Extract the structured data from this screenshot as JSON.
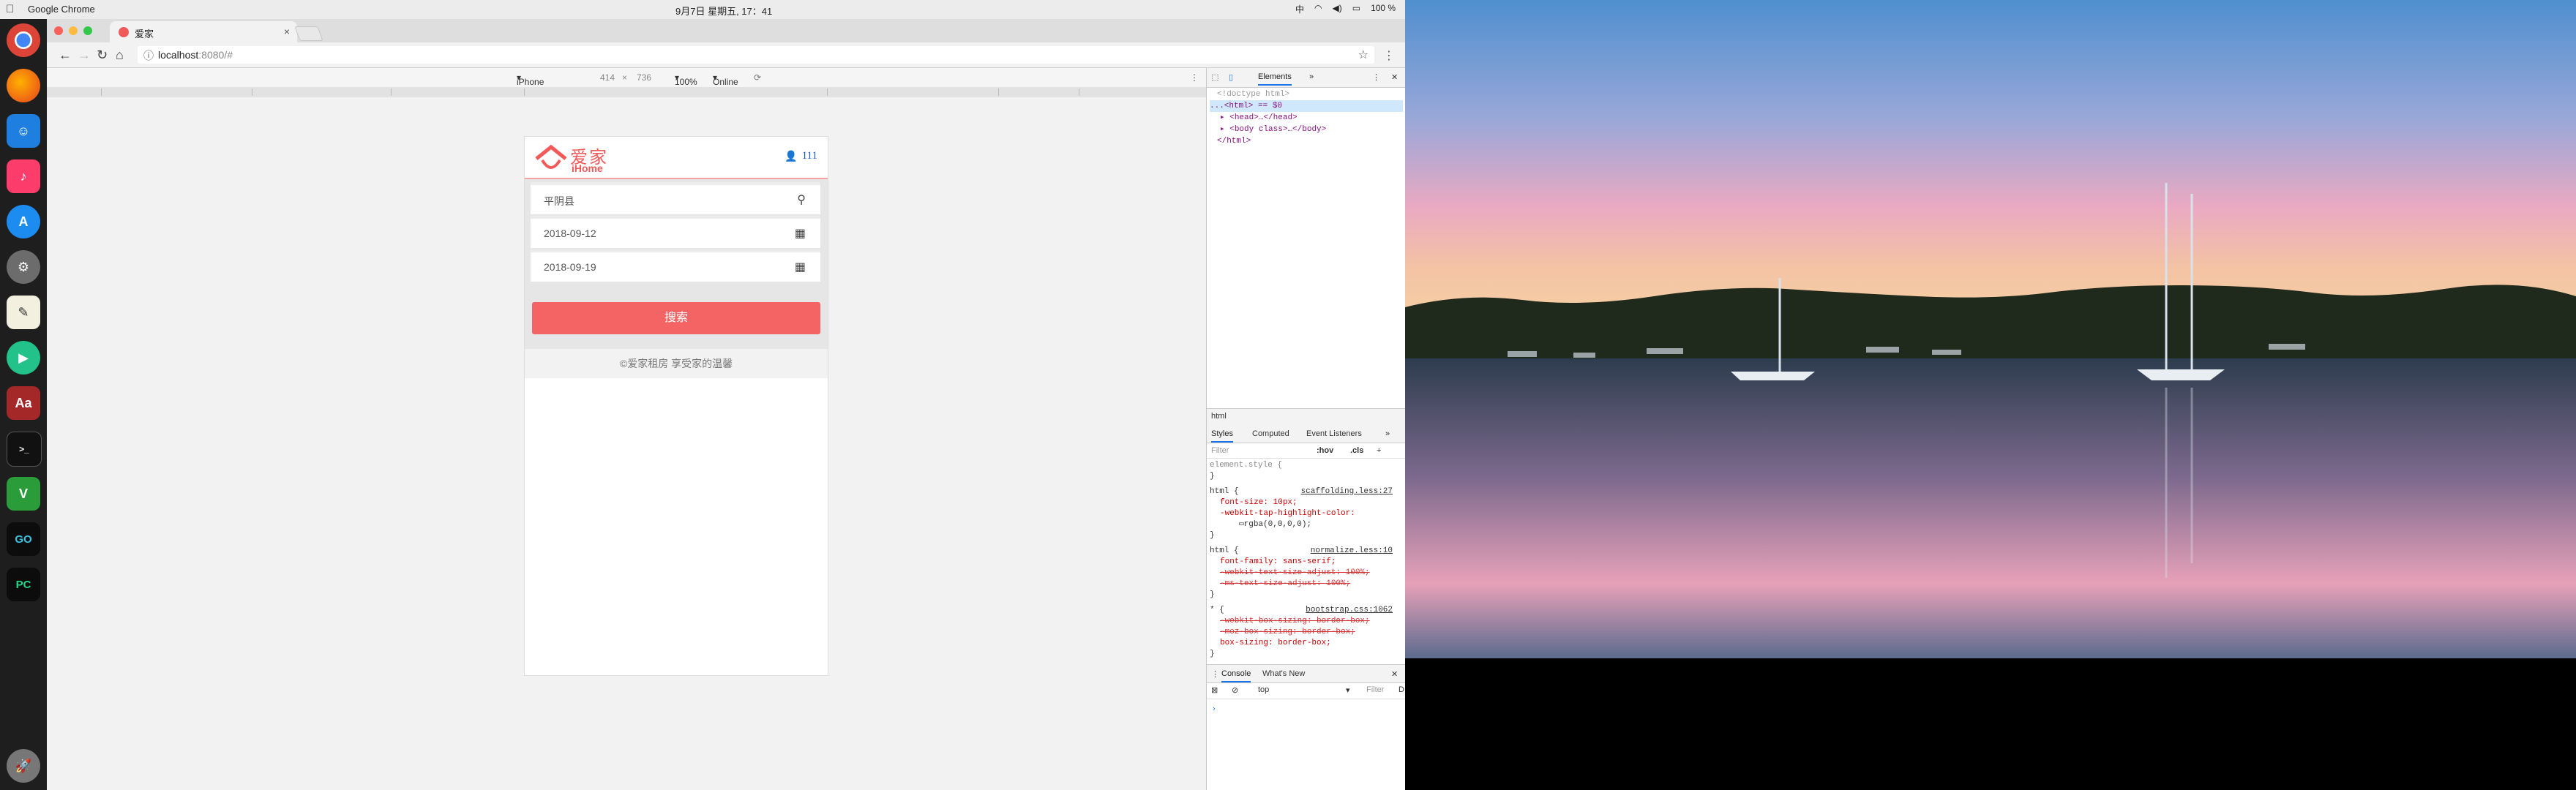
{
  "menubar": {
    "app_name": "Google Chrome",
    "clock": "9月7日 星期五, 17：41",
    "input_method": "中",
    "battery": "100 %"
  },
  "dock": {
    "items": [
      "chrome-icon",
      "firefox-icon",
      "finder-icon",
      "music-icon",
      "app-store-icon",
      "system-prefs-icon",
      "textedit-icon",
      "video-player-icon",
      "dictionary-icon",
      "terminal-icon",
      "vim-icon",
      "goland-icon",
      "pycharm-icon",
      "launchpad-icon"
    ]
  },
  "browser": {
    "tab_title": "爱家",
    "tab_close": "×",
    "url_host": "localhost",
    "url_rest": ":8080/#"
  },
  "device_toolbar": {
    "device": "iPhone 6/7...",
    "width": "414",
    "times": "×",
    "height": "736",
    "zoom": "100%",
    "network": "Online"
  },
  "page": {
    "logo_cn": "爱家",
    "logo_en": "iHome",
    "username": "111",
    "area_value": "平阴县",
    "start_date": "2018-09-12",
    "end_date": "2018-09-19",
    "search_button": "搜索",
    "footer": "©爱家租房  享受家的温馨"
  },
  "devtools": {
    "tab_elements": "Elements",
    "tab_more": "»",
    "dom_lines": {
      "doctype": "<!doctype html>",
      "html_open": "...<html> == $0",
      "head": "<head>…</head>",
      "body": "<body class>…</body>",
      "html_close": "</html>"
    },
    "breadcrumb": "html",
    "styles_tabs": {
      "styles": "Styles",
      "computed": "Computed",
      "listeners": "Event Listeners",
      "more": "»"
    },
    "filter_placeholder": "Filter",
    "hov": ":hov",
    "cls": ".cls",
    "plus": "+",
    "rules": {
      "element_style": "element.style {",
      "close": "}",
      "r1_selector": "html {",
      "r1_source": "scaffolding.less:27",
      "r1_p1": "font-size: 10px;",
      "r1_p2": "-webkit-tap-highlight-color:",
      "r1_p2b": "rgba(0,0,0,0);",
      "r2_selector": "html {",
      "r2_source": "normalize.less:10",
      "r2_p1": "font-family: sans-serif;",
      "r2_p2": "-webkit-text-size-adjust: 100%;",
      "r2_p3": "-ms-text-size-adjust: 100%;",
      "r3_selector": "* {",
      "r3_source": "bootstrap.css:1062",
      "r3_p1": "-webkit-box-sizing: border-box;",
      "r3_p2": "-moz-box-sizing: border-box;",
      "r3_p3": "box-sizing: border-box;"
    },
    "console_tab": "Console",
    "whats_new": "What's New",
    "context": "top",
    "console_filter": "Filter",
    "console_default": "D",
    "prompt": "›"
  },
  "colors": {
    "brand": "#f25a5a",
    "button": "#f56464",
    "link": "#1d5bd1"
  }
}
